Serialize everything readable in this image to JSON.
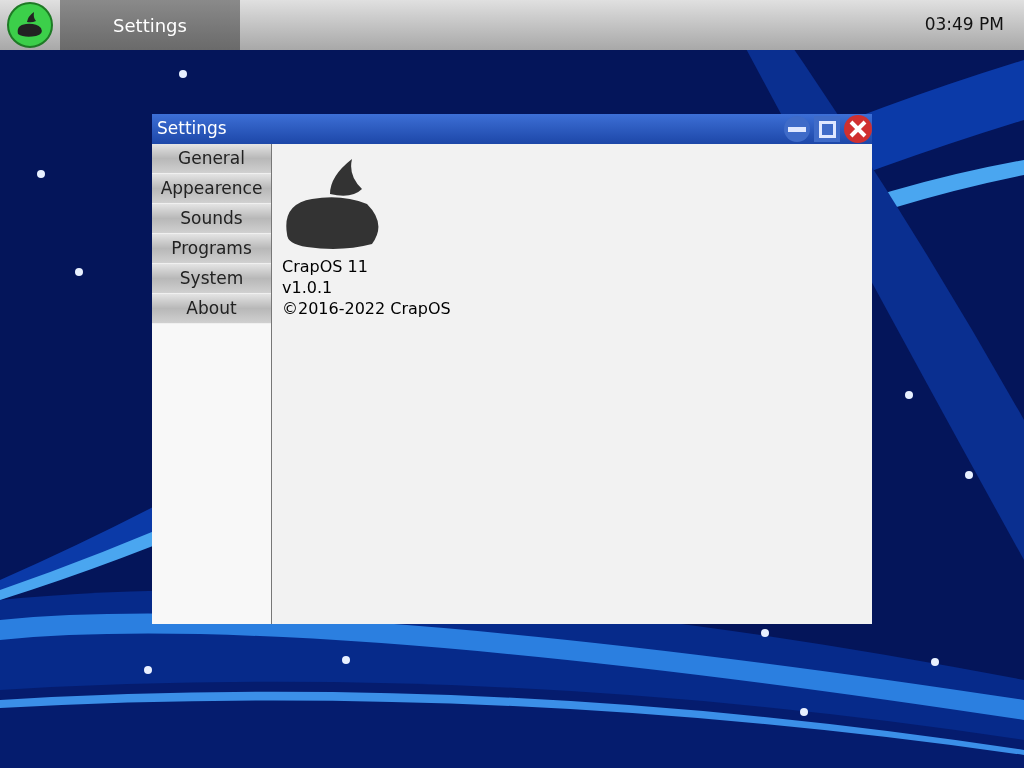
{
  "taskbar": {
    "task": "Settings",
    "clock": "03:49 PM"
  },
  "window": {
    "title": "Settings"
  },
  "sidebar": {
    "items": [
      {
        "label": "General"
      },
      {
        "label": "Appearence"
      },
      {
        "label": "Sounds"
      },
      {
        "label": "Programs"
      },
      {
        "label": "System"
      },
      {
        "label": "About"
      }
    ]
  },
  "about": {
    "lines": [
      "CrapOS 11",
      "v1.0.1",
      "©2016-2022 CrapOS"
    ]
  }
}
